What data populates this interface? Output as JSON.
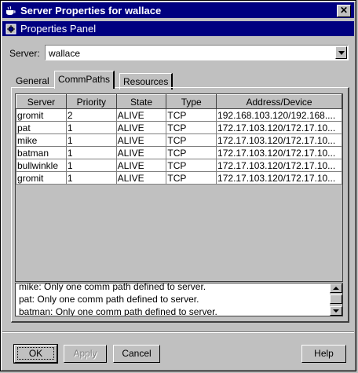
{
  "window": {
    "title": "Server Properties for wallace",
    "close_glyph": "✕"
  },
  "panel": {
    "title": "Properties Panel"
  },
  "server_field": {
    "label": "Server:",
    "value": "wallace"
  },
  "tabs": [
    {
      "label": "General",
      "selected": false
    },
    {
      "label": "CommPaths",
      "selected": true
    },
    {
      "label": "Resources",
      "selected": false
    }
  ],
  "table": {
    "columns": [
      "Server",
      "Priority",
      "State",
      "Type",
      "Address/Device"
    ],
    "rows": [
      [
        "gromit",
        "2",
        "ALIVE",
        "TCP",
        "192.168.103.120/192.168...."
      ],
      [
        "pat",
        "1",
        "ALIVE",
        "TCP",
        "172.17.103.120/172.17.10..."
      ],
      [
        "mike",
        "1",
        "ALIVE",
        "TCP",
        "172.17.103.120/172.17.10..."
      ],
      [
        "batman",
        "1",
        "ALIVE",
        "TCP",
        "172.17.103.120/172.17.10..."
      ],
      [
        "bullwinkle",
        "1",
        "ALIVE",
        "TCP",
        "172.17.103.120/172.17.10..."
      ],
      [
        "gromit",
        "1",
        "ALIVE",
        "TCP",
        "172.17.103.120/172.17.10..."
      ]
    ]
  },
  "messages": [
    "mike: Only one comm path defined to server.",
    "pat: Only one comm path defined to server.",
    "batman: Only one comm path defined to server."
  ],
  "buttons": {
    "ok": "OK",
    "apply": "Apply",
    "cancel": "Cancel",
    "help": "Help"
  },
  "colors": {
    "titlebar": "#000080",
    "face": "#c0c0c0",
    "disabled_text": "#808080"
  },
  "icons": {
    "window_icon": "java-cup-icon",
    "panel_icon": "gear-icon"
  }
}
